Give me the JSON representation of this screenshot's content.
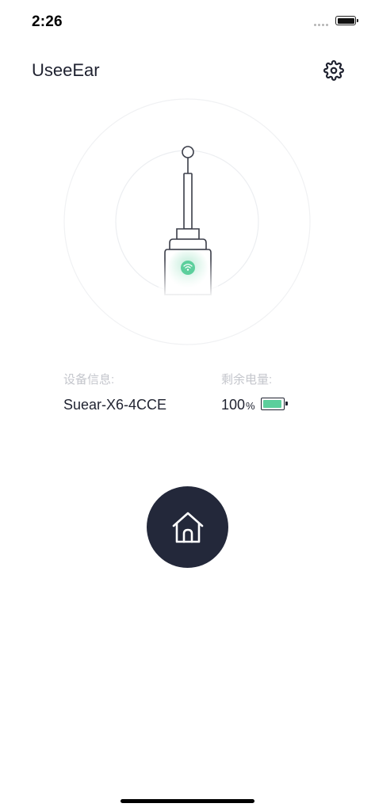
{
  "status_bar": {
    "time": "2:26"
  },
  "header": {
    "title": "UseeEar",
    "settings_icon": "gear-icon"
  },
  "device": {
    "image": "ear-cleaner-device",
    "wifi_icon": "wifi-icon"
  },
  "info": {
    "device_label": "设备信息:",
    "device_name": "Suear-X6-4CCE",
    "battery_label": "剩余电量:",
    "battery_value": "100",
    "battery_unit": "%",
    "battery_level": 1.0
  },
  "home_button": {
    "icon": "home-icon"
  },
  "colors": {
    "text_dark": "#1f2230",
    "label_gray": "#c4c6cc",
    "accent_green": "#5ccf9c",
    "button_dark": "#23283a",
    "ring": "#f0f1f3"
  }
}
